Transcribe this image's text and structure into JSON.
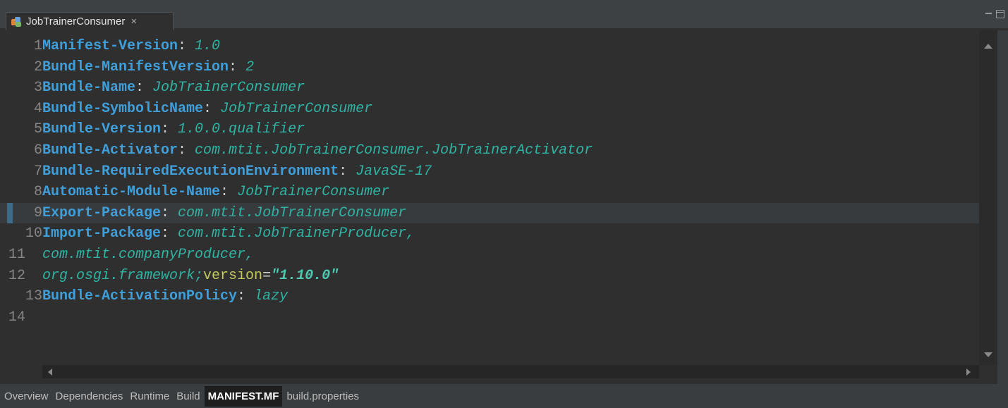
{
  "tab": {
    "title": "JobTrainerConsumer",
    "close_glyph": "×",
    "icon": "plugin-manifest-icon"
  },
  "editor": {
    "current_line": 9,
    "lines": [
      {
        "num": "1",
        "key": "Manifest-Version",
        "colon": ":",
        "value": " 1.0"
      },
      {
        "num": "2",
        "key": "Bundle-ManifestVersion",
        "colon": ":",
        "value": " 2"
      },
      {
        "num": "3",
        "key": "Bundle-Name",
        "colon": ":",
        "value": " JobTrainerConsumer"
      },
      {
        "num": "4",
        "key": "Bundle-SymbolicName",
        "colon": ":",
        "value": " JobTrainerConsumer"
      },
      {
        "num": "5",
        "key": "Bundle-Version",
        "colon": ":",
        "value": " 1.0.0.qualifier"
      },
      {
        "num": "6",
        "key": "Bundle-Activator",
        "colon": ":",
        "value": " com.mtit.JobTrainerConsumer.JobTrainerActivator"
      },
      {
        "num": "7",
        "key": "Bundle-RequiredExecutionEnvironment",
        "colon": ":",
        "value": " JavaSE-17"
      },
      {
        "num": "8",
        "key": "Automatic-Module-Name",
        "colon": ":",
        "value": " JobTrainerConsumer"
      },
      {
        "num": "9",
        "key": "Export-Package",
        "colon": ":",
        "value": " com.mtit.JobTrainerConsumer"
      },
      {
        "num": "10",
        "key": "Import-Package",
        "colon": ":",
        "value": " com.mtit.JobTrainerProducer,"
      },
      {
        "num": "11",
        "value": "  com.mtit.companyProducer,"
      },
      {
        "num": "12",
        "value": "  org.osgi.framework;",
        "attr": "version",
        "eq": "=",
        "str": "\"1.10.0\""
      },
      {
        "num": "13",
        "key": "Bundle-ActivationPolicy",
        "colon": ":",
        "value": " lazy"
      },
      {
        "num": "14"
      }
    ]
  },
  "page_tabs": [
    {
      "label": "Overview",
      "active": false
    },
    {
      "label": "Dependencies",
      "active": false
    },
    {
      "label": "Runtime",
      "active": false
    },
    {
      "label": "Build",
      "active": false
    },
    {
      "label": "MANIFEST.MF",
      "active": true
    },
    {
      "label": "build.properties",
      "active": false
    }
  ]
}
